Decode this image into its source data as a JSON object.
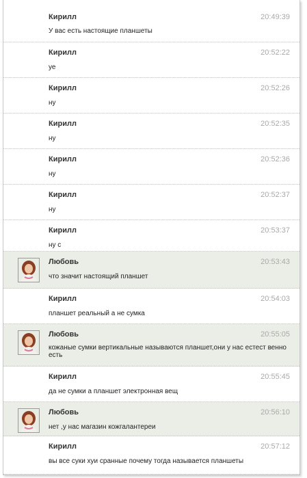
{
  "messages": [
    {
      "author": "Кирилл",
      "time": "20:49:39",
      "text": "У вас есть настоящие планшеты",
      "avatar": false
    },
    {
      "author": "Кирилл",
      "time": "20:52:22",
      "text": "уе",
      "avatar": false
    },
    {
      "author": "Кирилл",
      "time": "20:52:26",
      "text": "ну",
      "avatar": false
    },
    {
      "author": "Кирилл",
      "time": "20:52:35",
      "text": "ну",
      "avatar": false
    },
    {
      "author": "Кирилл",
      "time": "20:52:36",
      "text": "ну",
      "avatar": false
    },
    {
      "author": "Кирилл",
      "time": "20:52:37",
      "text": "ну",
      "avatar": false
    },
    {
      "author": "Кирилл",
      "time": "20:53:37",
      "text": "ну с",
      "avatar": false
    },
    {
      "author": "Любовь",
      "time": "20:53:43",
      "text": "что значит настоящий планшет",
      "avatar": true
    },
    {
      "author": "Кирилл",
      "time": "20:54:03",
      "text": "планшет реальный а не сумка",
      "avatar": false
    },
    {
      "author": "Любовь",
      "time": "20:55:05",
      "text": "кожаные сумки вертикальные называются планшет,они у нас естест венно есть",
      "avatar": true
    },
    {
      "author": "Кирилл",
      "time": "20:55:45",
      "text": "да не сумки а планшет электронная вещ",
      "avatar": false
    },
    {
      "author": "Любовь",
      "time": "20:56:10",
      "text": "нет ,у нас магазин кожгалантереи",
      "avatar": true
    },
    {
      "author": "Кирилл",
      "time": "20:57:12",
      "text": "вы все суки хуи сранные почему тогда называется планшеты",
      "avatar": false
    }
  ],
  "colors": {
    "highlight_row": "#ebeee6",
    "author": "#333333",
    "time": "#a9a9a9",
    "text": "#222222"
  },
  "icons": {
    "avatar": "user-photo-avatar"
  }
}
